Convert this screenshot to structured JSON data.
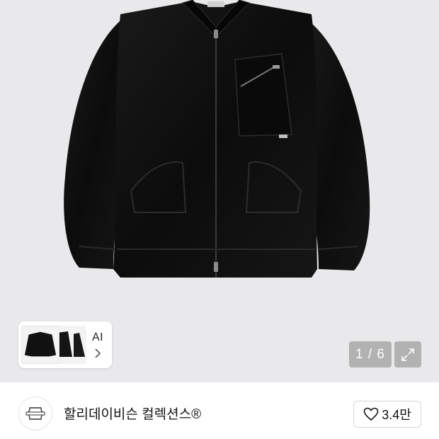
{
  "gallery": {
    "ai_label": "AI",
    "page_counter": "1 / 6",
    "current_page": 1,
    "total_pages": 6
  },
  "brand": {
    "name": "할리데이비슨 컬렉션스®",
    "logo_icon": "harley-shield-logo-icon"
  },
  "like": {
    "count": "3.4만",
    "icon": "heart-icon"
  },
  "colors": {
    "gallery_bg": "#e9e9eb",
    "jacket": "#111111",
    "counter_bg": "rgba(110,110,110,0.45)"
  }
}
